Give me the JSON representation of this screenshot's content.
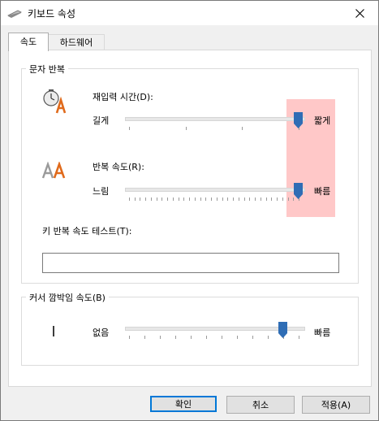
{
  "window": {
    "title": "키보드 속성"
  },
  "tabs": [
    {
      "label": "속도",
      "active": true
    },
    {
      "label": "하드웨어",
      "active": false
    }
  ],
  "char_repeat": {
    "group_label": "문자 반복",
    "delay": {
      "label": "재입력 시간(D):",
      "min_label": "길게",
      "max_label": "짧게",
      "value_fraction": 1.0
    },
    "rate": {
      "label": "반복 속도(R):",
      "min_label": "느림",
      "max_label": "빠름",
      "value_fraction": 1.0
    },
    "test_label": "키 반복 속도 테스트(T):",
    "test_value": ""
  },
  "cursor_blink": {
    "group_label": "커서 깜박임 속도(B)",
    "min_label": "없음",
    "max_label": "빠름",
    "value_fraction": 0.9
  },
  "buttons": {
    "ok": "확인",
    "cancel": "취소",
    "apply": "적용(A)"
  },
  "colors": {
    "accent": "#2f6db5",
    "highlight": "#ffa7a7",
    "default_button_border": "#0078d7"
  }
}
